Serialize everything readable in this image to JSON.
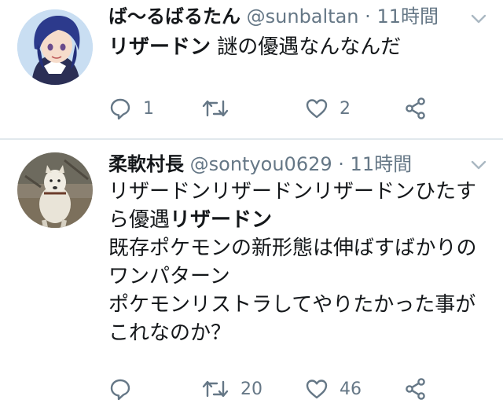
{
  "tweets": [
    {
      "name": "ば〜るばるたん",
      "handle": "@sunbaltan",
      "separator": "·",
      "time": "11時間",
      "lines": [
        [
          {
            "text": "リザードン",
            "bold": true
          },
          {
            "text": " 謎の優遇なんなんだ",
            "bold": false
          }
        ]
      ],
      "reply_count": "1",
      "retweet_count": "",
      "like_count": "2"
    },
    {
      "name": "柔軟村長",
      "handle": "@sontyou0629",
      "separator": "·",
      "time": "11時間",
      "lines": [
        [
          {
            "text": "リザードンリザードンリザードンひたす",
            "bold": false
          }
        ],
        [
          {
            "text": "ら優遇",
            "bold": false
          },
          {
            "text": "リザードン",
            "bold": true
          }
        ],
        [
          {
            "text": "既存ポケモンの新形態は伸ばすばかりの",
            "bold": false
          }
        ],
        [
          {
            "text": "ワンパターン",
            "bold": false
          }
        ],
        [
          {
            "text": "ポケモンリストラしてやりたかった事が",
            "bold": false
          }
        ],
        [
          {
            "text": "これなのか？",
            "bold": false
          }
        ]
      ],
      "reply_count": "",
      "retweet_count": "20",
      "like_count": "46"
    }
  ],
  "icons": {
    "reply": "reply-icon",
    "retweet": "retweet-icon",
    "like": "heart-icon",
    "share": "share-icon",
    "menu": "chevron-down-icon"
  },
  "colors": {
    "text": "#14171a",
    "secondary": "#657786",
    "divider": "#e1e8ed"
  }
}
